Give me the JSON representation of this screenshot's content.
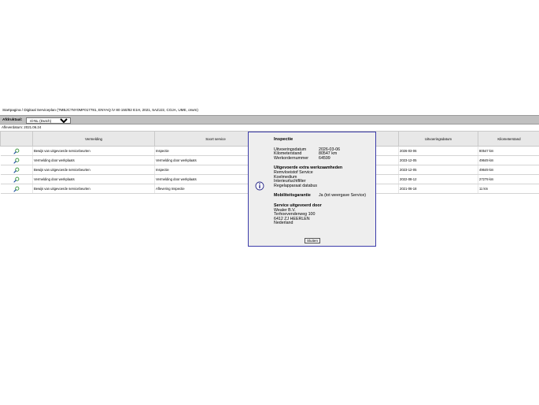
{
  "breadcrumb": "Startpagina / Digitaal Serviceplan (TMBJC7NY0MF017781, ENYAQ iV 80 150/82 E1H, 2021, 5AZJJ2, COJA, UME, orwm)",
  "toolbar": {
    "label": "Afdruktaal:",
    "language_selected": "nl-NL (Dutch)"
  },
  "delivery_date": "Afleverdatum: 2021.06.24",
  "table": {
    "headers": [
      "",
      "Vermelding",
      "Soort service",
      "",
      "Uitvoeringsdatum",
      "Kilometerstand"
    ],
    "rows": [
      {
        "vermelding": "Bewijs van uitgevoerde servicebeurten",
        "soort": "Inspectie",
        "datum": "2026-03-06",
        "km": "80547 km"
      },
      {
        "vermelding": "Vermelding door werkplaats",
        "soort": "Vermelding door werkplaats",
        "datum": "2023-12-05",
        "km": "49649 km"
      },
      {
        "vermelding": "Bewijs van uitgevoerde servicebeurten",
        "soort": "Inspectie",
        "datum": "2023-12-05",
        "km": "49649 km"
      },
      {
        "vermelding": "Vermelding door werkplaats",
        "soort": "Vermelding door werkplaats",
        "datum": "2022-08-12",
        "km": "27279 km"
      },
      {
        "vermelding": "Bewijs van uitgevoerde servicebeurten",
        "soort": "Aflevering Inspectie",
        "datum": "2021-06-18",
        "km": "11 km"
      }
    ]
  },
  "popup": {
    "title": "Inspectie",
    "fields": [
      {
        "label": "Uitvoeringsdatum",
        "value": "2026-03-06"
      },
      {
        "label": "Kilometerstand",
        "value": "80547 km"
      },
      {
        "label": "Werkordernummer",
        "value": "64599"
      }
    ],
    "extra_title": "Uitgevoerde extra werkzaamheden",
    "extra_items": [
      "Remvloeistof Service",
      "Koelmedium",
      "Interieurluchtfilter",
      "Regelapparaat databus"
    ],
    "mobility_label": "Mobiliteitsgarantie",
    "mobility_value": "Ja (tot weergave Service)",
    "performed_title": "Service uitgevoerd door",
    "performed_lines": [
      "Wealer B.V.",
      "Terhoevenderweg 100",
      "6412 ZJ HEERLEN",
      "Nederland"
    ],
    "close_label": "Sluiten"
  }
}
